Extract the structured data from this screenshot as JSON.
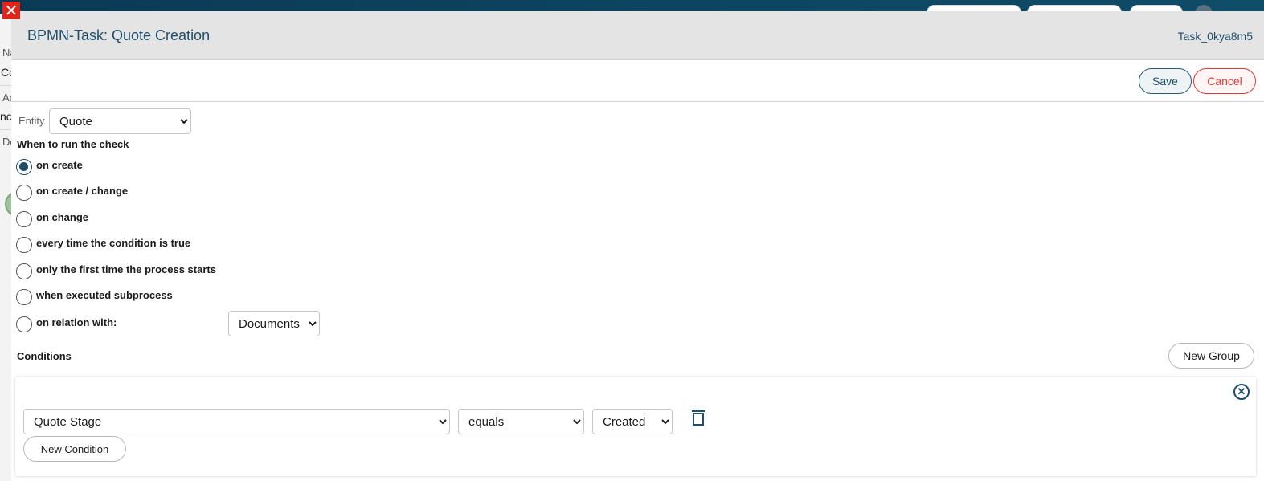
{
  "modal": {
    "title": "BPMN-Task: Quote Creation",
    "task_id": "Task_0kya8m5"
  },
  "actions": {
    "save_label": "Save",
    "cancel_label": "Cancel"
  },
  "entity": {
    "label": "Entity",
    "value": "Quote"
  },
  "run_check": {
    "title": "When to run the check",
    "options": [
      {
        "label": "on create",
        "checked": true
      },
      {
        "label": "on create / change",
        "checked": false
      },
      {
        "label": "on change",
        "checked": false
      },
      {
        "label": "every time the condition is true",
        "checked": false
      },
      {
        "label": "only the first time the process starts",
        "checked": false
      },
      {
        "label": "when executed subprocess",
        "checked": false
      },
      {
        "label": "on relation with:",
        "checked": false
      }
    ],
    "relation_value": "Documents"
  },
  "conditions": {
    "title": "Conditions",
    "new_group_label": "New Group",
    "new_condition_label": "New Condition",
    "row": {
      "field": "Quote Stage",
      "operator": "equals",
      "value": "Created"
    }
  },
  "background": {
    "fragments": [
      "Na",
      "Co",
      "Ac",
      "nc",
      "Do"
    ]
  },
  "colors": {
    "accent": "#1f4e69",
    "danger": "#e53935",
    "close": "#e1251b"
  },
  "icons": {
    "close": "close-icon",
    "trash": "trash-icon",
    "panel_close": "circle-x-icon"
  }
}
